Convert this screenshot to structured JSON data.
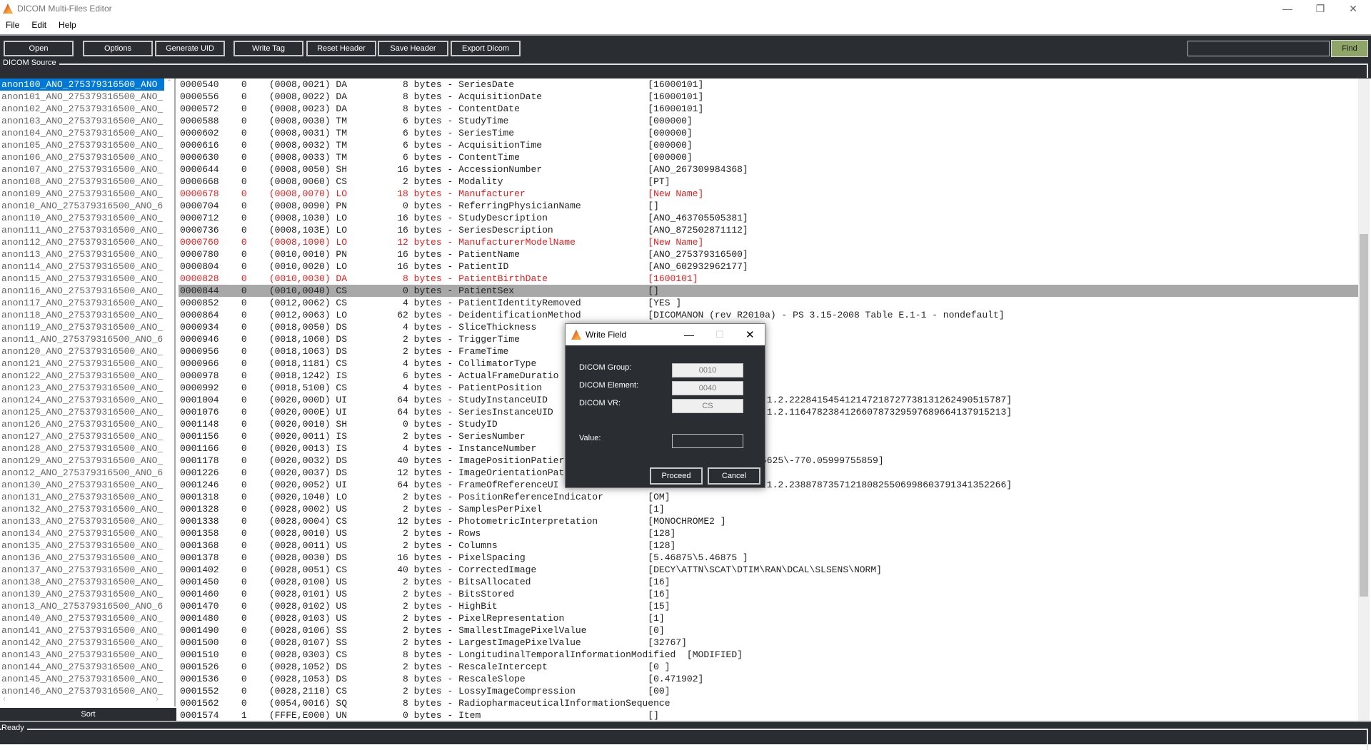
{
  "window": {
    "title": "DICOM Multi-Files Editor"
  },
  "menu": [
    "File",
    "Edit",
    "Help"
  ],
  "toolbar": {
    "open": "Open",
    "options": "Options",
    "generate_uid": "Generate UID",
    "write_tag": "Write Tag",
    "reset_header": "Reset Header",
    "save_header": "Save Header",
    "export_dicom": "Export Dicom",
    "search_value": "",
    "find": "Find"
  },
  "colors": {
    "toolbar_bg": "#2a2e33",
    "find_button": "#8ea567",
    "modified_text": "#e02020",
    "selection": "#0078d7",
    "highlight_row": "#a8a8a8"
  },
  "source_group": {
    "label": "DICOM Source"
  },
  "files": [
    "anon100_ANO_275379316500_ANO",
    "anon101_ANO_275379316500_ANO_",
    "anon102_ANO_275379316500_ANO_",
    "anon103_ANO_275379316500_ANO_",
    "anon104_ANO_275379316500_ANO_",
    "anon105_ANO_275379316500_ANO_",
    "anon106_ANO_275379316500_ANO_",
    "anon107_ANO_275379316500_ANO_",
    "anon108_ANO_275379316500_ANO_",
    "anon109_ANO_275379316500_ANO_",
    "anon10_ANO_275379316500_ANO_6",
    "anon110_ANO_275379316500_ANO_",
    "anon111_ANO_275379316500_ANO_",
    "anon112_ANO_275379316500_ANO_",
    "anon113_ANO_275379316500_ANO_",
    "anon114_ANO_275379316500_ANO_",
    "anon115_ANO_275379316500_ANO_",
    "anon116_ANO_275379316500_ANO_",
    "anon117_ANO_275379316500_ANO_",
    "anon118_ANO_275379316500_ANO_",
    "anon119_ANO_275379316500_ANO_",
    "anon11_ANO_275379316500_ANO_6",
    "anon120_ANO_275379316500_ANO_",
    "anon121_ANO_275379316500_ANO_",
    "anon122_ANO_275379316500_ANO_",
    "anon123_ANO_275379316500_ANO_",
    "anon124_ANO_275379316500_ANO_",
    "anon125_ANO_275379316500_ANO_",
    "anon126_ANO_275379316500_ANO_",
    "anon127_ANO_275379316500_ANO_",
    "anon128_ANO_275379316500_ANO_",
    "anon129_ANO_275379316500_ANO_",
    "anon12_ANO_275379316500_ANO_6",
    "anon130_ANO_275379316500_ANO_",
    "anon131_ANO_275379316500_ANO_",
    "anon132_ANO_275379316500_ANO_",
    "anon133_ANO_275379316500_ANO_",
    "anon134_ANO_275379316500_ANO_",
    "anon135_ANO_275379316500_ANO_",
    "anon136_ANO_275379316500_ANO_",
    "anon137_ANO_275379316500_ANO_",
    "anon138_ANO_275379316500_ANO_",
    "anon139_ANO_275379316500_ANO_",
    "anon13_ANO_275379316500_ANO_6",
    "anon140_ANO_275379316500_ANO_",
    "anon141_ANO_275379316500_ANO_",
    "anon142_ANO_275379316500_ANO_",
    "anon143_ANO_275379316500_ANO_",
    "anon144_ANO_275379316500_ANO_",
    "anon145_ANO_275379316500_ANO_",
    "anon146_ANO_275379316500_ANO_"
  ],
  "selected_file_index": 0,
  "sort_label": "Sort",
  "tags": [
    {
      "offset": "0000540",
      "level": "0",
      "tag": "(0008,0021)",
      "vr": "DA",
      "bytes": "8",
      "name": "SeriesDate",
      "value": "[16000101]"
    },
    {
      "offset": "0000556",
      "level": "0",
      "tag": "(0008,0022)",
      "vr": "DA",
      "bytes": "8",
      "name": "AcquisitionDate",
      "value": "[16000101]"
    },
    {
      "offset": "0000572",
      "level": "0",
      "tag": "(0008,0023)",
      "vr": "DA",
      "bytes": "8",
      "name": "ContentDate",
      "value": "[16000101]"
    },
    {
      "offset": "0000588",
      "level": "0",
      "tag": "(0008,0030)",
      "vr": "TM",
      "bytes": "6",
      "name": "StudyTime",
      "value": "[000000]"
    },
    {
      "offset": "0000602",
      "level": "0",
      "tag": "(0008,0031)",
      "vr": "TM",
      "bytes": "6",
      "name": "SeriesTime",
      "value": "[000000]"
    },
    {
      "offset": "0000616",
      "level": "0",
      "tag": "(0008,0032)",
      "vr": "TM",
      "bytes": "6",
      "name": "AcquisitionTime",
      "value": "[000000]"
    },
    {
      "offset": "0000630",
      "level": "0",
      "tag": "(0008,0033)",
      "vr": "TM",
      "bytes": "6",
      "name": "ContentTime",
      "value": "[000000]"
    },
    {
      "offset": "0000644",
      "level": "0",
      "tag": "(0008,0050)",
      "vr": "SH",
      "bytes": "16",
      "name": "AccessionNumber",
      "value": "[ANO_267309984368]"
    },
    {
      "offset": "0000668",
      "level": "0",
      "tag": "(0008,0060)",
      "vr": "CS",
      "bytes": "2",
      "name": "Modality",
      "value": "[PT]"
    },
    {
      "offset": "0000678",
      "level": "0",
      "tag": "(0008,0070)",
      "vr": "LO",
      "bytes": "18",
      "name": "Manufacturer",
      "value": "[New Name]",
      "modified": true
    },
    {
      "offset": "0000704",
      "level": "0",
      "tag": "(0008,0090)",
      "vr": "PN",
      "bytes": "0",
      "name": "ReferringPhysicianName",
      "value": "[]"
    },
    {
      "offset": "0000712",
      "level": "0",
      "tag": "(0008,1030)",
      "vr": "LO",
      "bytes": "16",
      "name": "StudyDescription",
      "value": "[ANO_463705505381]"
    },
    {
      "offset": "0000736",
      "level": "0",
      "tag": "(0008,103E)",
      "vr": "LO",
      "bytes": "16",
      "name": "SeriesDescription",
      "value": "[ANO_872502871112]"
    },
    {
      "offset": "0000760",
      "level": "0",
      "tag": "(0008,1090)",
      "vr": "LO",
      "bytes": "12",
      "name": "ManufacturerModelName",
      "value": "[New Name]",
      "modified": true
    },
    {
      "offset": "0000780",
      "level": "0",
      "tag": "(0010,0010)",
      "vr": "PN",
      "bytes": "16",
      "name": "PatientName",
      "value": "[ANO_275379316500]"
    },
    {
      "offset": "0000804",
      "level": "0",
      "tag": "(0010,0020)",
      "vr": "LO",
      "bytes": "16",
      "name": "PatientID",
      "value": "[ANO_602932962177]"
    },
    {
      "offset": "0000828",
      "level": "0",
      "tag": "(0010,0030)",
      "vr": "DA",
      "bytes": "8",
      "name": "PatientBirthDate",
      "value": "[1600101]",
      "modified": true
    },
    {
      "offset": "0000844",
      "level": "0",
      "tag": "(0010,0040)",
      "vr": "CS",
      "bytes": "0",
      "name": "PatientSex",
      "value": "[]",
      "selected": true
    },
    {
      "offset": "0000852",
      "level": "0",
      "tag": "(0012,0062)",
      "vr": "CS",
      "bytes": "4",
      "name": "PatientIdentityRemoved",
      "value": "[YES ]"
    },
    {
      "offset": "0000864",
      "level": "0",
      "tag": "(0012,0063)",
      "vr": "LO",
      "bytes": "62",
      "name": "DeidentificationMethod",
      "value": "[DICOMANON (rev R2010a) - PS 3.15-2008 Table E.1-1 - nondefault]"
    },
    {
      "offset": "0000934",
      "level": "0",
      "tag": "(0018,0050)",
      "vr": "DS",
      "bytes": "4",
      "name": "SliceThickness",
      "value": ""
    },
    {
      "offset": "0000946",
      "level": "0",
      "tag": "(0018,1060)",
      "vr": "DS",
      "bytes": "2",
      "name": "TriggerTime",
      "value": ""
    },
    {
      "offset": "0000956",
      "level": "0",
      "tag": "(0018,1063)",
      "vr": "DS",
      "bytes": "2",
      "name": "FrameTime",
      "value": ""
    },
    {
      "offset": "0000966",
      "level": "0",
      "tag": "(0018,1181)",
      "vr": "CS",
      "bytes": "4",
      "name": "CollimatorType",
      "value": ""
    },
    {
      "offset": "0000978",
      "level": "0",
      "tag": "(0018,1242)",
      "vr": "IS",
      "bytes": "6",
      "name": "ActualFrameDuratio",
      "value": ""
    },
    {
      "offset": "0000992",
      "level": "0",
      "tag": "(0018,5100)",
      "vr": "CS",
      "bytes": "4",
      "name": "PatientPosition",
      "value": ""
    },
    {
      "offset": "0001004",
      "level": "0",
      "tag": "(0020,000D)",
      "vr": "UI",
      "bytes": "64",
      "name": "StudyInstanceUID",
      "value": "",
      "value_tail": ".1.2.222841545412147218727738131262490515787]"
    },
    {
      "offset": "0001076",
      "level": "0",
      "tag": "(0020,000E)",
      "vr": "UI",
      "bytes": "64",
      "name": "SeriesInstanceUID",
      "value": "",
      "value_tail": ".1.2.116478238412660787329597689664137915213]"
    },
    {
      "offset": "0001148",
      "level": "0",
      "tag": "(0020,0010)",
      "vr": "SH",
      "bytes": "0",
      "name": "StudyID",
      "value": ""
    },
    {
      "offset": "0001156",
      "level": "0",
      "tag": "(0020,0011)",
      "vr": "IS",
      "bytes": "2",
      "name": "SeriesNumber",
      "value": ""
    },
    {
      "offset": "0001166",
      "level": "0",
      "tag": "(0020,0013)",
      "vr": "IS",
      "bytes": "4",
      "name": "InstanceNumber",
      "value": ""
    },
    {
      "offset": "0001178",
      "level": "0",
      "tag": "(0020,0032)",
      "vr": "DS",
      "bytes": "40",
      "name": "ImagePositionPatier",
      "value": "",
      "value_tail": "5625\\-770.05999755859]"
    },
    {
      "offset": "0001226",
      "level": "0",
      "tag": "(0020,0037)",
      "vr": "DS",
      "bytes": "12",
      "name": "ImageOrientationPat",
      "value": ""
    },
    {
      "offset": "0001246",
      "level": "0",
      "tag": "(0020,0052)",
      "vr": "UI",
      "bytes": "64",
      "name": "FrameOfReferenceUI",
      "value": "",
      "value_tail": ".1.2.238878735712180825506998603791341352266]"
    },
    {
      "offset": "0001318",
      "level": "0",
      "tag": "(0020,1040)",
      "vr": "LO",
      "bytes": "2",
      "name": "PositionReferenceIndicator",
      "value": "[OM]"
    },
    {
      "offset": "0001328",
      "level": "0",
      "tag": "(0028,0002)",
      "vr": "US",
      "bytes": "2",
      "name": "SamplesPerPixel",
      "value": "[1]"
    },
    {
      "offset": "0001338",
      "level": "0",
      "tag": "(0028,0004)",
      "vr": "CS",
      "bytes": "12",
      "name": "PhotometricInterpretation",
      "value": "[MONOCHROME2 ]"
    },
    {
      "offset": "0001358",
      "level": "0",
      "tag": "(0028,0010)",
      "vr": "US",
      "bytes": "2",
      "name": "Rows",
      "value": "[128]"
    },
    {
      "offset": "0001368",
      "level": "0",
      "tag": "(0028,0011)",
      "vr": "US",
      "bytes": "2",
      "name": "Columns",
      "value": "[128]"
    },
    {
      "offset": "0001378",
      "level": "0",
      "tag": "(0028,0030)",
      "vr": "DS",
      "bytes": "16",
      "name": "PixelSpacing",
      "value": "[5.46875\\5.46875 ]"
    },
    {
      "offset": "0001402",
      "level": "0",
      "tag": "(0028,0051)",
      "vr": "CS",
      "bytes": "40",
      "name": "CorrectedImage",
      "value": "[DECY\\ATTN\\SCAT\\DTIM\\RAN\\DCAL\\SLSENS\\NORM]"
    },
    {
      "offset": "0001450",
      "level": "0",
      "tag": "(0028,0100)",
      "vr": "US",
      "bytes": "2",
      "name": "BitsAllocated",
      "value": "[16]"
    },
    {
      "offset": "0001460",
      "level": "0",
      "tag": "(0028,0101)",
      "vr": "US",
      "bytes": "2",
      "name": "BitsStored",
      "value": "[16]"
    },
    {
      "offset": "0001470",
      "level": "0",
      "tag": "(0028,0102)",
      "vr": "US",
      "bytes": "2",
      "name": "HighBit",
      "value": "[15]"
    },
    {
      "offset": "0001480",
      "level": "0",
      "tag": "(0028,0103)",
      "vr": "US",
      "bytes": "2",
      "name": "PixelRepresentation",
      "value": "[1]"
    },
    {
      "offset": "0001490",
      "level": "0",
      "tag": "(0028,0106)",
      "vr": "SS",
      "bytes": "2",
      "name": "SmallestImagePixelValue",
      "value": "[0]"
    },
    {
      "offset": "0001500",
      "level": "0",
      "tag": "(0028,0107)",
      "vr": "SS",
      "bytes": "2",
      "name": "LargestImagePixelValue",
      "value": "[32767]"
    },
    {
      "offset": "0001510",
      "level": "0",
      "tag": "(0028,0303)",
      "vr": "CS",
      "bytes": "8",
      "name": "LongitudinalTemporalInformationModified",
      "value": "[MODIFIED]"
    },
    {
      "offset": "0001526",
      "level": "0",
      "tag": "(0028,1052)",
      "vr": "DS",
      "bytes": "2",
      "name": "RescaleIntercept",
      "value": "[0 ]"
    },
    {
      "offset": "0001536",
      "level": "0",
      "tag": "(0028,1053)",
      "vr": "DS",
      "bytes": "8",
      "name": "RescaleSlope",
      "value": "[0.471902]"
    },
    {
      "offset": "0001552",
      "level": "0",
      "tag": "(0028,2110)",
      "vr": "CS",
      "bytes": "2",
      "name": "LossyImageCompression",
      "value": "[00]"
    },
    {
      "offset": "0001562",
      "level": "0",
      "tag": "(0054,0016)",
      "vr": "SQ",
      "bytes": "8",
      "name": "RadiopharmaceuticalInformationSequence",
      "value": ""
    },
    {
      "offset": "0001574",
      "level": "1",
      "tag": "(FFFE,E000)",
      "vr": "UN",
      "bytes": "0",
      "name": "Item",
      "value": "[]"
    }
  ],
  "status": {
    "label": "Ready"
  },
  "dialog": {
    "title": "Write Field",
    "group_label": "DICOM Group:",
    "group_value": "0010",
    "element_label": "DICOM Element:",
    "element_value": "0040",
    "vr_label": "DICOM VR:",
    "vr_value": "CS",
    "value_label": "Value:",
    "value_value": "",
    "proceed": "Proceed",
    "cancel": "Cancel"
  }
}
